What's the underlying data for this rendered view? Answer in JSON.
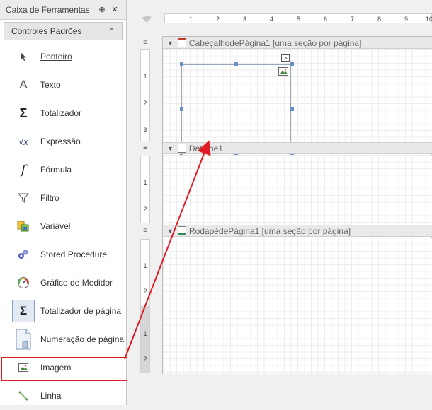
{
  "toolbox": {
    "title": "Caixa de Ferramentas",
    "pin_glyph": "⊕",
    "close_glyph": "✕",
    "group": {
      "label": "Controles Padrões",
      "chevron": "⌃"
    },
    "items": [
      {
        "label": "Ponteiro",
        "icon": "pointer-icon"
      },
      {
        "label": "Texto",
        "icon": "text-icon",
        "glyph": "A"
      },
      {
        "label": "Totalizador",
        "icon": "sigma-icon",
        "glyph": "Σ"
      },
      {
        "label": "Expressão",
        "icon": "sqrt-icon",
        "glyph": "√x"
      },
      {
        "label": "Fórmula",
        "icon": "function-icon",
        "glyph": "f"
      },
      {
        "label": "Filtro",
        "icon": "filter-icon"
      },
      {
        "label": "Variável",
        "icon": "variable-icon"
      },
      {
        "label": "Stored Procedure",
        "icon": "stored-procedure-icon"
      },
      {
        "label": "Gráfico de Medidor",
        "icon": "gauge-icon"
      },
      {
        "label": "Totalizador de página",
        "icon": "page-sigma-icon",
        "glyph": "Σ"
      },
      {
        "label": "Numeração de página",
        "icon": "page-number-icon"
      },
      {
        "label": "Imagem",
        "icon": "image-icon"
      },
      {
        "label": "Linha",
        "icon": "line-icon"
      }
    ]
  },
  "ruler": {
    "h_ticks": [
      "1",
      "2",
      "3",
      "4",
      "5",
      "6",
      "7",
      "8",
      "9",
      "10"
    ],
    "header_ticks": [
      "1",
      "2",
      "3"
    ],
    "detail_ticks": [
      "1",
      "2"
    ],
    "footer_ticks": [
      "1",
      "2",
      "1",
      "2"
    ]
  },
  "bands": {
    "menu_glyph": "≡",
    "toggle_glyph": "▼",
    "page_header": "CabeçalhodePágina1 [uma seção por página]",
    "detail": "Detalhe1",
    "page_footer": "RodapédePágina1 [uma seção por página]"
  },
  "picture_box": {
    "smart_tag_glyph": ">"
  },
  "colors": {
    "highlight": "#e01b24",
    "handle": "#6a8fc4",
    "band_header": "#e9e9e9"
  }
}
